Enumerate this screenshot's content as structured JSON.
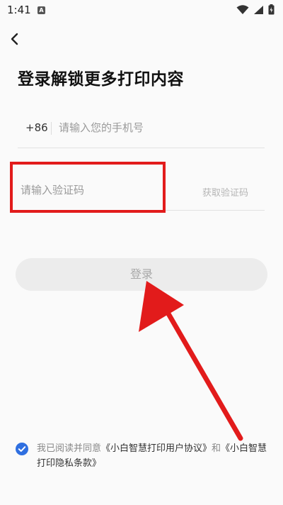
{
  "status": {
    "time": "1:41",
    "notif_icon": "a-icon"
  },
  "header": {
    "back_icon": "chevron-left-icon",
    "title": "登录解锁更多打印内容"
  },
  "phone": {
    "country_code": "+86",
    "placeholder": "请输入您的手机号"
  },
  "code": {
    "placeholder": "请输入验证码",
    "get_code_label": "获取验证码"
  },
  "login": {
    "label": "登录"
  },
  "agreement": {
    "prefix": "我已阅读并同意",
    "user_agreement": "《小白智慧打印用户协议》",
    "and": "和",
    "privacy_policy": "《小白智慧打印隐私条款》",
    "checked": true,
    "check_color": "#2f6fe0"
  },
  "annotation": {
    "box_color": "#e21b1b",
    "arrow_color": "#e21b1b"
  }
}
